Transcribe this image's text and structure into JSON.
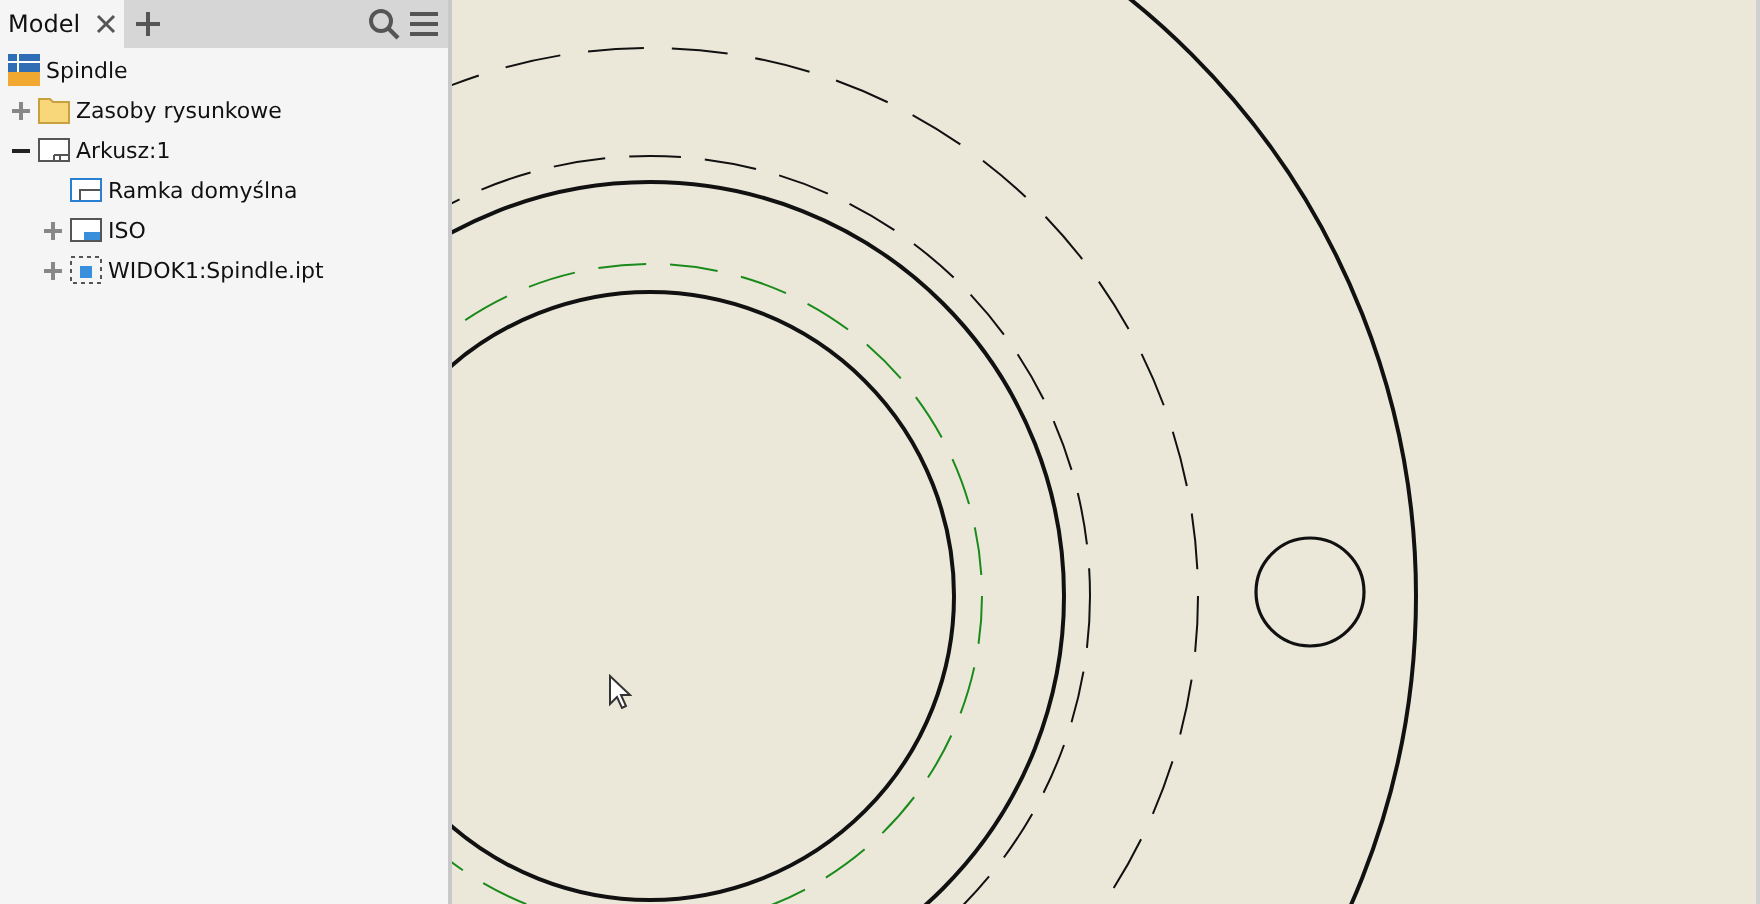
{
  "panel": {
    "tabs": [
      {
        "label": "Model",
        "selected": true
      }
    ]
  },
  "tree": [
    {
      "label": "Spindle",
      "kind": "drawing",
      "children": [
        {
          "label": "Zasoby rysunkowe",
          "kind": "folder",
          "expanded": false
        },
        {
          "label": "Arkusz:1",
          "kind": "sheet",
          "expanded": true,
          "children": [
            {
              "label": "Ramka domyślna",
              "kind": "border"
            },
            {
              "label": "ISO",
              "kind": "titleblock",
              "expanded": false
            },
            {
              "label": "WIDOK1:Spindle.ipt",
              "kind": "view",
              "expanded": false
            }
          ]
        }
      ]
    }
  ]
}
